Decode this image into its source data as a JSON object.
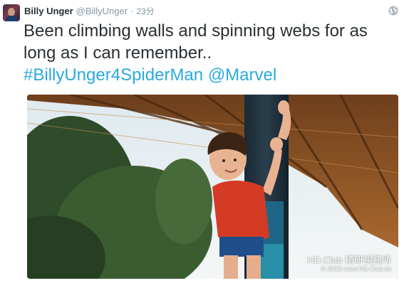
{
  "tweet": {
    "author": {
      "display_name": "Billy Unger",
      "handle": "@BillyUnger"
    },
    "separator": "·",
    "time": "23分",
    "text": "Been climbing walls and spinning webs for as long as I can remember..",
    "hashtag": "#BillyUnger4SpiderMan",
    "mention": "@Marvel"
  },
  "photo": {
    "watermark": {
      "brand": "HD.Club 精研視務所",
      "line": "© 2015  www.HD.Club.tw"
    }
  },
  "icons": {
    "header": "globe-icon"
  },
  "colors": {
    "link": "#2aa9e0",
    "name": "#292f33",
    "meta": "#8899a6"
  }
}
